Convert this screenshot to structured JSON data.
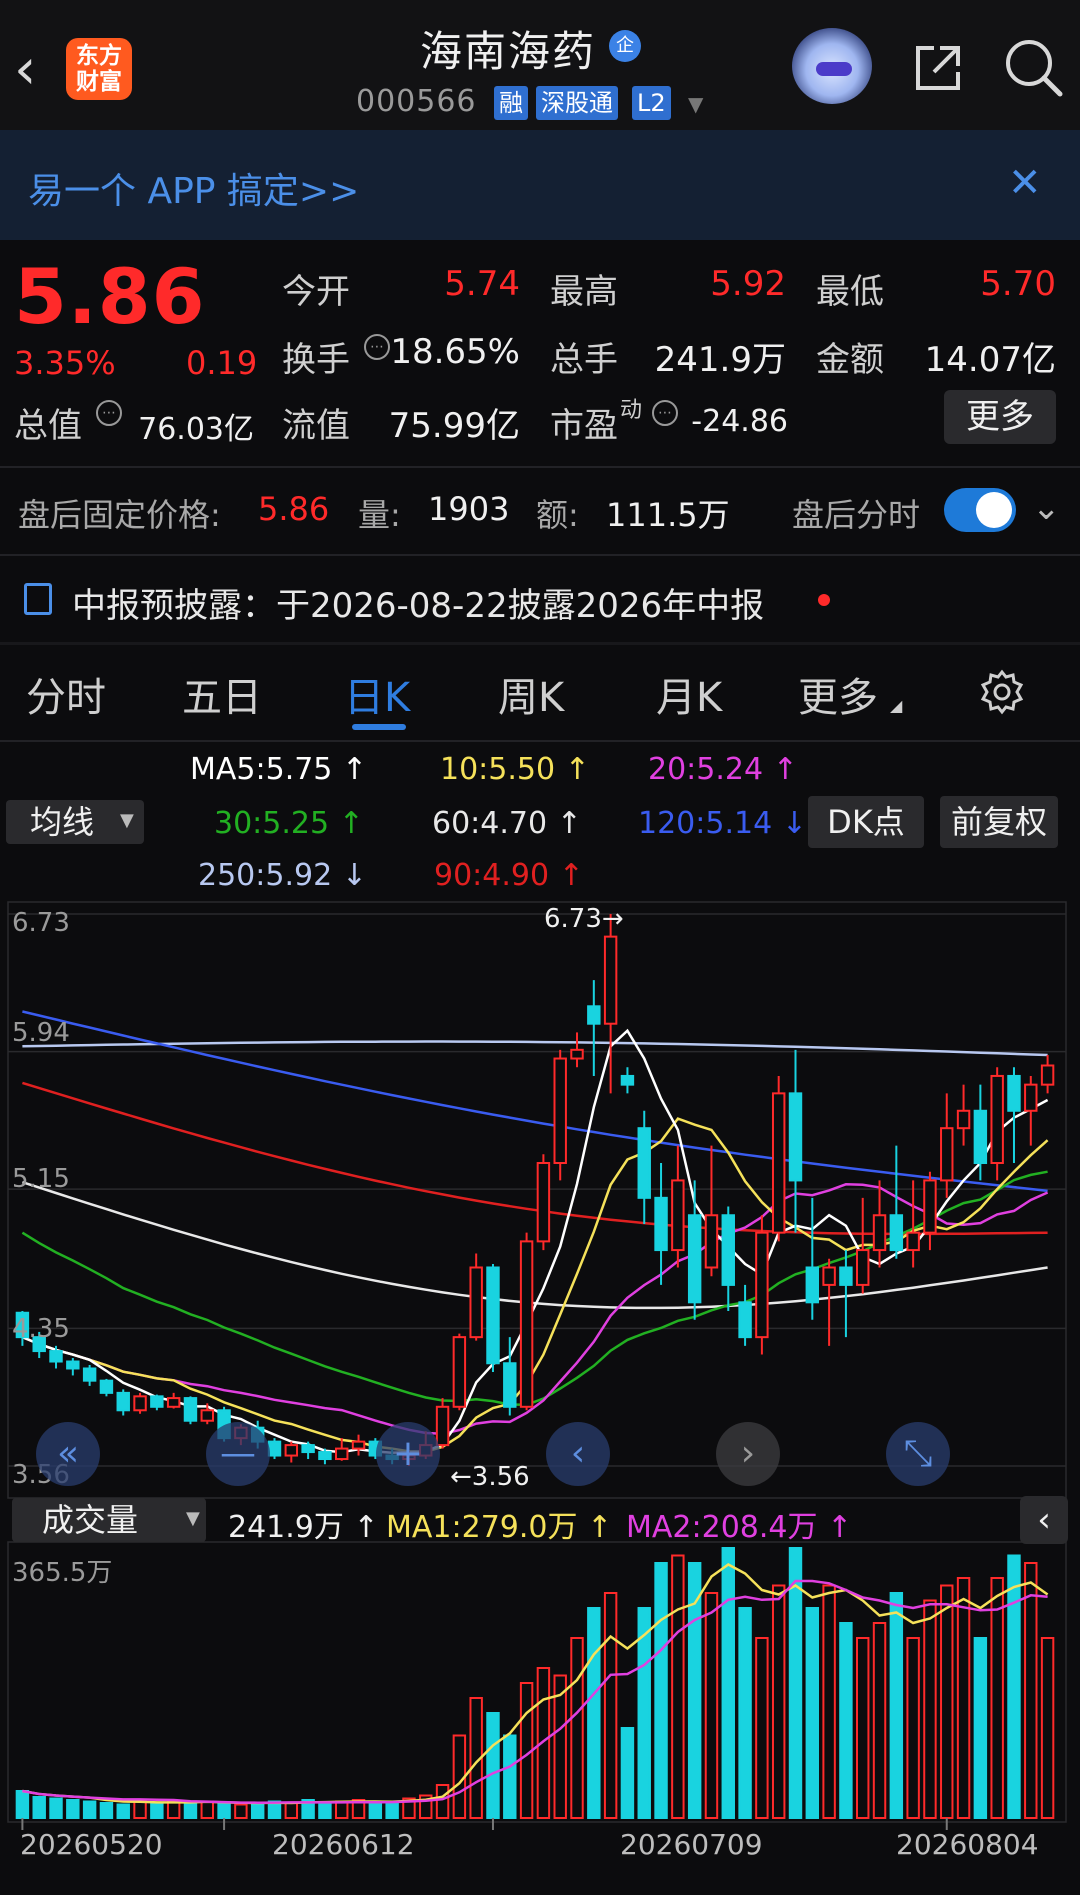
{
  "header": {
    "back": "‹",
    "logo_line1": "东方",
    "logo_line2": "财富",
    "title": "海南海药",
    "qi_badge": "企",
    "code": "000566",
    "tags": [
      "融",
      "深股通",
      "L2"
    ]
  },
  "banner": {
    "text": "易一个 APP 搞定>>",
    "close": "✕"
  },
  "quote": {
    "price": "5.86",
    "pct": "3.35%",
    "change": "0.19",
    "open_label": "今开",
    "open": "5.74",
    "high_label": "最高",
    "high": "5.92",
    "low_label": "最低",
    "low": "5.70",
    "turnover_label": "换手",
    "turnover": "18.65%",
    "volume_label": "总手",
    "volume": "241.9万",
    "amount_label": "金额",
    "amount": "14.07亿",
    "mktcap_label": "总值",
    "mktcap": "76.03亿",
    "float_label": "流值",
    "float": "75.99亿",
    "pe_label": "市盈",
    "pe_sup": "动",
    "pe": "-24.86",
    "more": "更多"
  },
  "after_hours": {
    "label": "盘后固定价格:",
    "price": "5.86",
    "vol_label": "量:",
    "vol": "1903",
    "amt_label": "额:",
    "amt": "111.5万",
    "switch_label": "盘后分时"
  },
  "notice": {
    "text": "中报预披露：于2026-08-22披露2026年中报"
  },
  "tabs": [
    "分时",
    "五日",
    "日K",
    "周K",
    "月K",
    "更多"
  ],
  "ma_legend": {
    "ma5": "MA5:5.75 ↑",
    "ma10": "10:5.50 ↑",
    "ma20": "20:5.24 ↑",
    "ma30": "30:5.25 ↑",
    "ma60": "60:4.70 ↑",
    "ma120": "120:5.14 ↓",
    "ma250": "250:5.92 ↓",
    "ma90": "90:4.90 ↑",
    "junxian": "均线",
    "dk": "DK点",
    "fuquan": "前复权"
  },
  "colors": {
    "up": "#ff2a2a",
    "down": "#19d3e0",
    "ma5": "#ffffff",
    "ma10": "#f5e15a",
    "ma20": "#e040e0",
    "ma30": "#22b022",
    "ma60": "#e8e8e8",
    "ma120": "#3a5cf0",
    "ma250": "#b8c8f0",
    "ma90": "#e02020"
  },
  "chart_data": {
    "type": "candlestick",
    "y_axis_labels": [
      "6.73",
      "5.94",
      "5.15",
      "4.35",
      "3.56"
    ],
    "ylim": [
      3.56,
      6.73
    ],
    "annotations": [
      "6.73→",
      "←3.56"
    ],
    "x_tick_labels": [
      "20260520",
      "20260612",
      "20260709",
      "20260804"
    ],
    "volume": {
      "max_label": "365.5万",
      "latest": "241.9万 ↑",
      "ma1": "MA1:279.0万 ↑",
      "ma2": "MA2:208.4万 ↑",
      "button": "成交量"
    },
    "candles": [
      [
        4.44,
        4.3,
        4.45,
        4.25
      ],
      [
        4.3,
        4.22,
        4.33,
        4.18
      ],
      [
        4.22,
        4.16,
        4.25,
        4.12
      ],
      [
        4.16,
        4.12,
        4.18,
        4.08
      ],
      [
        4.12,
        4.05,
        4.14,
        4.02
      ],
      [
        4.05,
        3.98,
        4.06,
        3.96
      ],
      [
        3.98,
        3.88,
        4.0,
        3.85
      ],
      [
        3.88,
        3.96,
        3.98,
        3.86
      ],
      [
        3.96,
        3.9,
        3.97,
        3.88
      ],
      [
        3.9,
        3.95,
        3.98,
        3.89
      ],
      [
        3.95,
        3.82,
        3.96,
        3.8
      ],
      [
        3.82,
        3.88,
        3.92,
        3.8
      ],
      [
        3.88,
        3.72,
        3.9,
        3.7
      ],
      [
        3.72,
        3.78,
        3.8,
        3.68
      ],
      [
        3.78,
        3.7,
        3.82,
        3.66
      ],
      [
        3.7,
        3.62,
        3.72,
        3.6
      ],
      [
        3.62,
        3.68,
        3.7,
        3.58
      ],
      [
        3.68,
        3.64,
        3.7,
        3.6
      ],
      [
        3.64,
        3.6,
        3.66,
        3.57
      ],
      [
        3.6,
        3.66,
        3.72,
        3.59
      ],
      [
        3.66,
        3.7,
        3.74,
        3.62
      ],
      [
        3.7,
        3.62,
        3.72,
        3.6
      ],
      [
        3.62,
        3.6,
        3.66,
        3.57
      ],
      [
        3.6,
        3.62,
        3.65,
        3.56
      ],
      [
        3.62,
        3.68,
        3.76,
        3.6
      ],
      [
        3.68,
        3.9,
        3.95,
        3.66
      ],
      [
        3.9,
        4.3,
        4.32,
        3.88
      ],
      [
        4.3,
        4.7,
        4.78,
        4.28
      ],
      [
        4.7,
        4.15,
        4.72,
        4.1
      ],
      [
        4.15,
        3.9,
        4.3,
        3.85
      ],
      [
        3.9,
        4.85,
        4.9,
        3.88
      ],
      [
        4.85,
        5.3,
        5.35,
        4.8
      ],
      [
        5.3,
        5.9,
        5.95,
        5.2
      ],
      [
        5.9,
        5.95,
        6.05,
        5.85
      ],
      [
        6.2,
        6.1,
        6.35,
        5.8
      ],
      [
        6.1,
        6.6,
        6.73,
        5.7
      ],
      [
        5.8,
        5.75,
        5.85,
        5.7
      ],
      [
        5.5,
        5.1,
        5.6,
        4.95
      ],
      [
        5.1,
        4.8,
        5.3,
        4.6
      ],
      [
        4.8,
        5.2,
        5.4,
        4.7
      ],
      [
        5.0,
        4.5,
        5.2,
        4.4
      ],
      [
        4.7,
        5.0,
        5.4,
        4.65
      ],
      [
        5.0,
        4.6,
        5.05,
        4.45
      ],
      [
        4.5,
        4.3,
        4.6,
        4.25
      ],
      [
        4.3,
        4.9,
        5.0,
        4.2
      ],
      [
        4.9,
        5.7,
        5.8,
        4.85
      ],
      [
        5.7,
        5.2,
        5.95,
        4.9
      ],
      [
        4.7,
        4.5,
        5.1,
        4.4
      ],
      [
        4.6,
        4.7,
        4.75,
        4.25
      ],
      [
        4.7,
        4.6,
        4.8,
        4.3
      ],
      [
        4.6,
        4.8,
        5.1,
        4.55
      ],
      [
        4.8,
        5.0,
        5.2,
        4.7
      ],
      [
        5.0,
        4.8,
        5.4,
        4.75
      ],
      [
        4.8,
        4.9,
        5.2,
        4.7
      ],
      [
        4.9,
        5.2,
        5.25,
        4.8
      ],
      [
        5.2,
        5.5,
        5.7,
        5.1
      ],
      [
        5.5,
        5.6,
        5.75,
        5.4
      ],
      [
        5.6,
        5.3,
        5.75,
        5.2
      ],
      [
        5.3,
        5.8,
        5.85,
        5.2
      ],
      [
        5.8,
        5.6,
        5.85,
        5.3
      ],
      [
        5.6,
        5.75,
        5.8,
        5.4
      ],
      [
        5.75,
        5.86,
        5.92,
        5.7
      ]
    ],
    "volumes": [
      0.18,
      0.14,
      0.13,
      0.12,
      0.11,
      0.1,
      0.09,
      0.12,
      0.1,
      0.11,
      0.1,
      0.11,
      0.1,
      0.09,
      0.1,
      0.11,
      0.1,
      0.12,
      0.1,
      0.11,
      0.12,
      0.1,
      0.11,
      0.13,
      0.15,
      0.22,
      0.55,
      0.8,
      0.7,
      0.55,
      0.9,
      1.0,
      0.95,
      1.2,
      1.4,
      1.5,
      0.6,
      1.4,
      1.7,
      1.75,
      1.7,
      1.5,
      1.8,
      1.4,
      1.2,
      1.55,
      1.8,
      1.4,
      1.55,
      1.3,
      1.2,
      1.3,
      1.5,
      1.2,
      1.45,
      1.55,
      1.6,
      1.2,
      1.6,
      1.75,
      1.7,
      1.2
    ]
  }
}
